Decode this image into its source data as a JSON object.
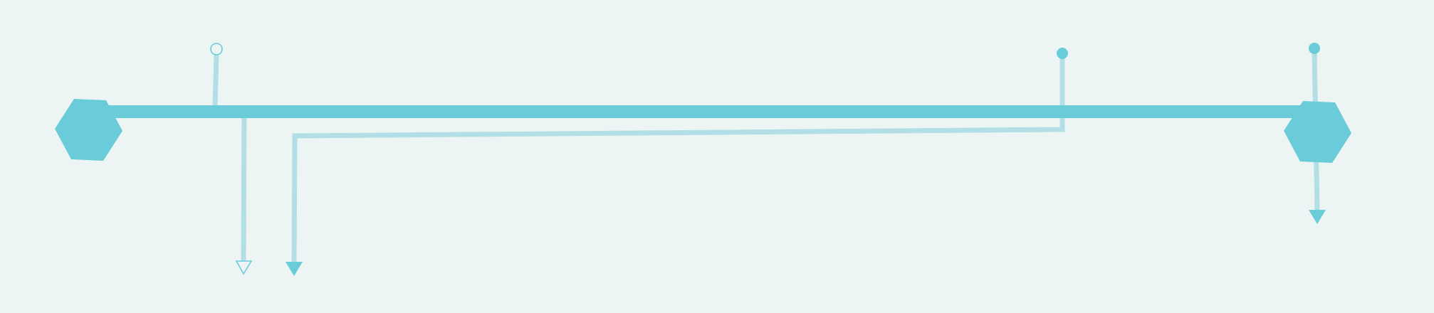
{
  "colors": {
    "background": "#edf5f4",
    "main_bar": "#6bccd9",
    "connector": "#b2dfe6",
    "end_node": "#6bccd9",
    "arrow_fill": "#6bccd9",
    "hollow_stroke": "#6bccd9"
  },
  "diagram": {
    "shapes": [
      "hexagon",
      "hexagon"
    ],
    "connector_ends": [
      "open-circle",
      "filled-circle",
      "filled-circle",
      "hollow-triangle",
      "filled-triangle",
      "filled-triangle"
    ]
  }
}
